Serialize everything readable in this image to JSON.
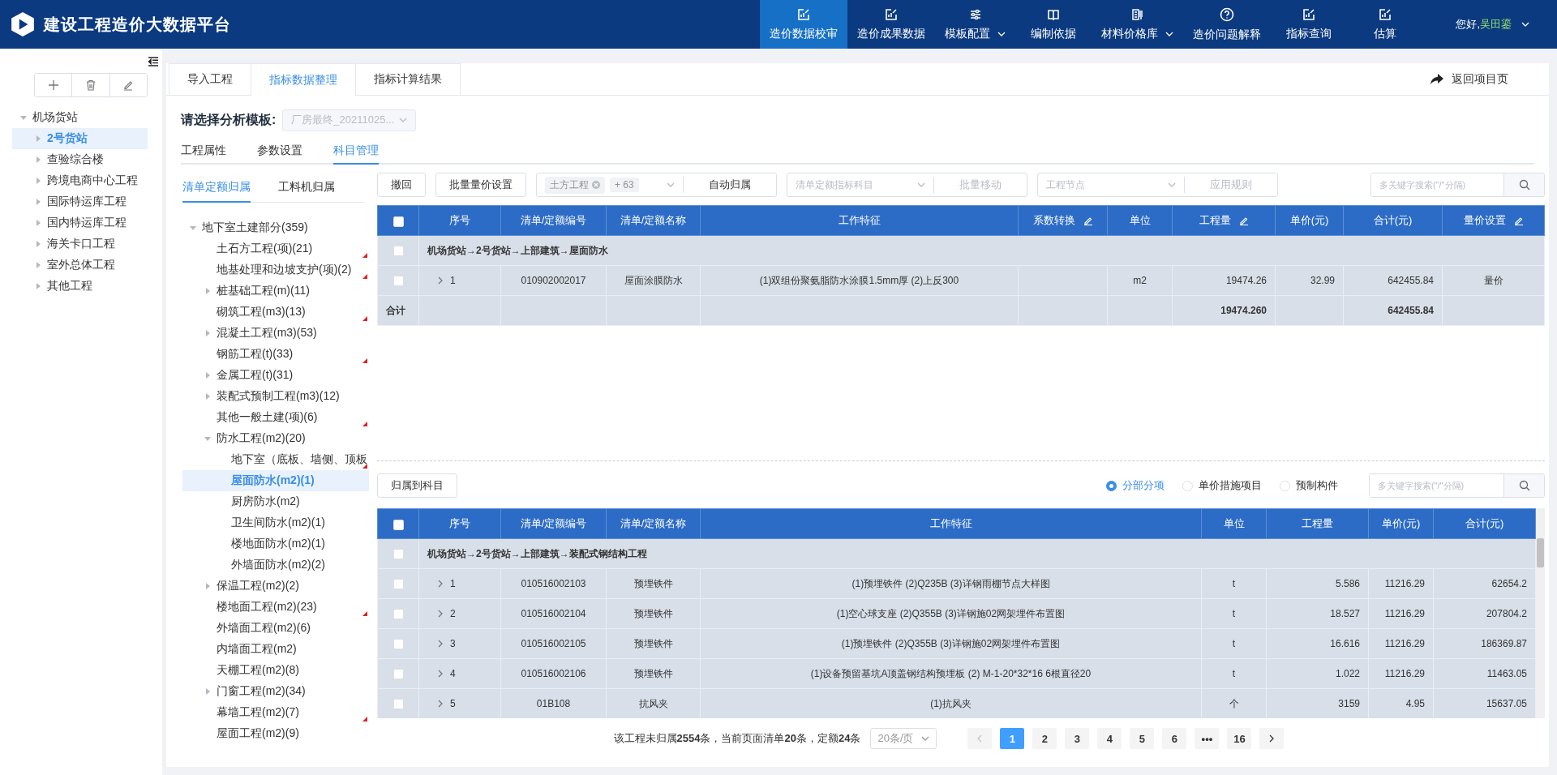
{
  "header": {
    "title": "建设工程造价大数据平台",
    "nav": [
      {
        "label": "造价数据校审",
        "selected": true,
        "has_menu": false
      },
      {
        "label": "造价成果数据",
        "selected": false,
        "has_menu": false
      },
      {
        "label": "模板配置",
        "selected": false,
        "has_menu": true
      },
      {
        "label": "编制依据",
        "selected": false,
        "has_menu": false
      },
      {
        "label": "材料价格库",
        "selected": false,
        "has_menu": true
      },
      {
        "label": "造价问题解释",
        "selected": false,
        "has_menu": false
      },
      {
        "label": "指标查询",
        "selected": false,
        "has_menu": false
      },
      {
        "label": "估算",
        "selected": false,
        "has_menu": false
      }
    ],
    "greeting": "您好,",
    "user": "吴田鎏"
  },
  "sidebar": {
    "tree": [
      {
        "label": "机场货站",
        "selected": false,
        "expanded": true,
        "children": [
          {
            "label": "2号货站",
            "selected": true,
            "expanded": false
          },
          {
            "label": "查验综合楼",
            "selected": false,
            "expanded": false
          },
          {
            "label": "跨境电商中心工程",
            "selected": false,
            "expanded": false
          },
          {
            "label": "国际特运库工程",
            "selected": false,
            "expanded": false
          },
          {
            "label": "国内特运库工程",
            "selected": false,
            "expanded": false
          },
          {
            "label": "海关卡口工程",
            "selected": false,
            "expanded": false
          },
          {
            "label": "室外总体工程",
            "selected": false,
            "expanded": false
          },
          {
            "label": "其他工程",
            "selected": false,
            "expanded": false
          }
        ]
      }
    ]
  },
  "tabs": [
    {
      "label": "导入工程",
      "selected": false
    },
    {
      "label": "指标数据整理",
      "selected": true
    },
    {
      "label": "指标计算结果",
      "selected": false
    }
  ],
  "return_link": "返回项目页",
  "template": {
    "label": "请选择分析模板:",
    "value": "厂房最终_20211025...",
    "disabled": true
  },
  "sub_tabs": [
    {
      "label": "工程属性",
      "selected": false
    },
    {
      "label": "参数设置",
      "selected": false
    },
    {
      "label": "科目管理",
      "selected": true
    }
  ],
  "subject_tree": {
    "tabs": [
      {
        "label": "清单定额归属",
        "selected": true
      },
      {
        "label": "工料机归属",
        "selected": false
      }
    ],
    "nodes": [
      {
        "label": "地下室土建部分(359)",
        "selected": false,
        "flagged": false,
        "expanded": true,
        "children": [
          {
            "label": "土石方工程(项)(21)",
            "selected": false,
            "flagged": true
          },
          {
            "label": "地基处理和边坡支护(项)(2)",
            "selected": false,
            "flagged": true
          },
          {
            "label": "桩基础工程(m)(11)",
            "selected": false,
            "flagged": false,
            "expanded": false
          },
          {
            "label": "砌筑工程(m3)(13)",
            "selected": false,
            "flagged": true
          },
          {
            "label": "混凝土工程(m3)(53)",
            "selected": false,
            "flagged": false,
            "expanded": false
          },
          {
            "label": "钢筋工程(t)(33)",
            "selected": false,
            "flagged": true
          },
          {
            "label": "金属工程(t)(31)",
            "selected": false,
            "flagged": false,
            "expanded": false
          },
          {
            "label": "装配式预制工程(m3)(12)",
            "selected": false,
            "flagged": false,
            "expanded": false
          },
          {
            "label": "其他一般土建(项)(6)",
            "selected": false,
            "flagged": true
          },
          {
            "label": "防水工程(m2)(20)",
            "selected": false,
            "flagged": false,
            "expanded": true,
            "children": [
              {
                "label": "地下室（底板、墙侧、顶板",
                "selected": false,
                "flagged": true
              },
              {
                "label": "屋面防水(m2)(1)",
                "selected": true,
                "flagged": false
              },
              {
                "label": "厨房防水(m2)",
                "selected": false,
                "flagged": false
              },
              {
                "label": "卫生间防水(m2)(1)",
                "selected": false,
                "flagged": false
              },
              {
                "label": "楼地面防水(m2)(1)",
                "selected": false,
                "flagged": false
              },
              {
                "label": "外墙面防水(m2)(2)",
                "selected": false,
                "flagged": false
              }
            ]
          },
          {
            "label": "保温工程(m2)(2)",
            "selected": false,
            "flagged": false,
            "expanded": false
          },
          {
            "label": "楼地面工程(m2)(23)",
            "selected": false,
            "flagged": true
          },
          {
            "label": "外墙面工程(m2)(6)",
            "selected": false,
            "flagged": false
          },
          {
            "label": "内墙面工程(m2)",
            "selected": false,
            "flagged": false
          },
          {
            "label": "天棚工程(m2)(8)",
            "selected": false,
            "flagged": false
          },
          {
            "label": "门窗工程(m2)(34)",
            "selected": false,
            "flagged": false,
            "expanded": false
          },
          {
            "label": "幕墙工程(m2)(7)",
            "selected": false,
            "flagged": true
          },
          {
            "label": "屋面工程(m2)(9)",
            "selected": false,
            "flagged": false
          }
        ]
      }
    ]
  },
  "toolbar": {
    "buttons": [
      "撤回",
      "批量量价设置"
    ],
    "subject_filter": {
      "tags": [
        {
          "label": "土方工程",
          "closable": true
        },
        {
          "label": "+ 63",
          "closable": false
        }
      ],
      "action": "自动归属"
    },
    "index_subject": {
      "placeholder": "清单定额指标科目",
      "action": "批量移动",
      "action_disabled": true
    },
    "node": {
      "placeholder": "工程节点",
      "action": "应用规则",
      "action_disabled": true
    },
    "search": {
      "placeholder": "多关键字搜索(\"/\"分隔)"
    }
  },
  "assigned_table": {
    "select_all": false,
    "columns": [
      {
        "label": "序号",
        "editable": false
      },
      {
        "label": "清单/定额编号",
        "editable": false
      },
      {
        "label": "清单/定额名称",
        "editable": false
      },
      {
        "label": "工作特征",
        "editable": false
      },
      {
        "label": "系数转换",
        "editable": true
      },
      {
        "label": "单位",
        "editable": false
      },
      {
        "label": "工程量",
        "editable": true
      },
      {
        "label": "单价(元)",
        "editable": false
      },
      {
        "label": "合计(元)",
        "editable": false
      },
      {
        "label": "量价设置",
        "editable": true
      }
    ],
    "rows": [
      {
        "kind": "group",
        "checked": false,
        "label": "机场货站→2号货站→上部建筑→屋面防水"
      },
      {
        "kind": "item",
        "checked": false,
        "expanded": false,
        "no": "1",
        "code": "010902002017",
        "name": "屋面涂膜防水",
        "feature": "(1)双组份聚氨脂防水涂膜1.5mm厚 (2)上反300",
        "unit": "m2",
        "quantity": "19474.26",
        "price": "32.99",
        "total": "642455.84",
        "setting": "量价"
      },
      {
        "kind": "total",
        "label": "合计",
        "quantity": "19474.260",
        "total": "642455.84"
      }
    ]
  },
  "lower_toolbar": {
    "assign_button": "归属到科目",
    "scope_options": [
      {
        "label": "分部分项",
        "selected": true
      },
      {
        "label": "单价措施项目",
        "selected": false
      },
      {
        "label": "预制构件",
        "selected": false
      }
    ],
    "search": {
      "placeholder": "多关键字搜索(\"/\"分隔)"
    }
  },
  "unassigned_table": {
    "select_all": false,
    "columns": [
      {
        "label": "序号",
        "editable": false
      },
      {
        "label": "清单/定额编号",
        "editable": false
      },
      {
        "label": "清单/定额名称",
        "editable": false
      },
      {
        "label": "工作特征",
        "editable": false
      },
      {
        "label": "单位",
        "editable": false
      },
      {
        "label": "工程量",
        "editable": false
      },
      {
        "label": "单价(元)",
        "editable": false
      },
      {
        "label": "合计(元)",
        "editable": false
      }
    ],
    "rows": [
      {
        "kind": "group",
        "checked": false,
        "label": "机场货站→2号货站→上部建筑→装配式钢结构工程"
      },
      {
        "kind": "item",
        "checked": false,
        "expanded": false,
        "no": "1",
        "code": "010516002103",
        "name": "预埋铁件",
        "feature": "(1)预埋铁件 (2)Q235B (3)详钢雨棚节点大样图",
        "unit": "t",
        "quantity": "5.586",
        "price": "11216.29",
        "total": "62654.2"
      },
      {
        "kind": "item",
        "checked": false,
        "expanded": false,
        "no": "2",
        "code": "010516002104",
        "name": "预埋铁件",
        "feature": "(1)空心球支座 (2)Q355B (3)详钢施02网架埋件布置图",
        "unit": "t",
        "quantity": "18.527",
        "price": "11216.29",
        "total": "207804.2"
      },
      {
        "kind": "item",
        "checked": false,
        "expanded": false,
        "no": "3",
        "code": "010516002105",
        "name": "预埋铁件",
        "feature": "(1)预埋铁件 (2)Q355B (3)详钢施02网架埋件布置图",
        "unit": "t",
        "quantity": "16.616",
        "price": "11216.29",
        "total": "186369.87"
      },
      {
        "kind": "item",
        "checked": false,
        "expanded": false,
        "no": "4",
        "code": "010516002106",
        "name": "预埋铁件",
        "feature": "(1)设备预留基坑A顶盖钢结构预埋板 (2) M-1-20*32*16 6根直径20",
        "unit": "t",
        "quantity": "1.022",
        "price": "11216.29",
        "total": "11463.05"
      },
      {
        "kind": "item",
        "checked": false,
        "expanded": false,
        "no": "5",
        "code": "01B108",
        "name": "抗风夹",
        "feature": "(1)抗风夹",
        "unit": "个",
        "quantity": "3159",
        "price": "4.95",
        "total": "15637.05"
      }
    ]
  },
  "pager": {
    "summary": "该工程未归属**2554**条，当前页面清单**20**条，定额**24**条",
    "page_size": "20条/页",
    "pages": [
      {
        "label": "1",
        "selected": true
      },
      {
        "label": "2",
        "selected": false
      },
      {
        "label": "3",
        "selected": false
      },
      {
        "label": "4",
        "selected": false
      },
      {
        "label": "5",
        "selected": false
      },
      {
        "label": "6",
        "selected": false
      },
      {
        "label": "•••",
        "selected": false
      },
      {
        "label": "16",
        "selected": false
      }
    ]
  }
}
